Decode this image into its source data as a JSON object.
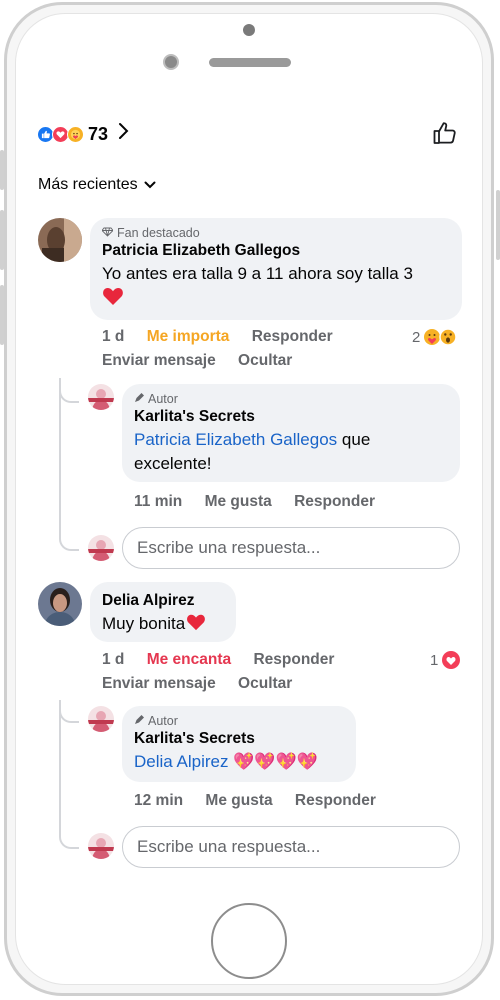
{
  "header": {
    "reaction_icons": [
      "like-icon",
      "love-icon",
      "care-icon"
    ],
    "reaction_count": "73",
    "like_icon": "thumbs-up-icon"
  },
  "sort": {
    "label": "Más recientes"
  },
  "comments": [
    {
      "badge": "Fan destacado",
      "author": "Patricia Elizabeth Gallegos",
      "text": "Yo antes era talla 9 a 11 ahora soy talla 3",
      "emoji": "❤️",
      "time": "1 d",
      "reaction_action": "Me importa",
      "reply_label": "Responder",
      "send_message": "Enviar mensaje",
      "hide": "Ocultar",
      "reaction_count": "2",
      "reply": {
        "badge": "Autor",
        "author": "Karlita's Secrets",
        "mention": "Patricia Elizabeth Gallegos",
        "text": "que excelente!",
        "time": "11 min",
        "like": "Me gusta",
        "reply_label": "Responder"
      },
      "input_placeholder": "Escribe una respuesta..."
    },
    {
      "author": "Delia Alpirez",
      "text": "Muy bonita",
      "emoji": "❤️",
      "time": "1 d",
      "reaction_action": "Me encanta",
      "reply_label": "Responder",
      "send_message": "Enviar mensaje",
      "hide": "Ocultar",
      "reaction_count": "1",
      "reply": {
        "badge": "Autor",
        "author": "Karlita's Secrets",
        "mention": "Delia Alpirez",
        "emojis": "💖💖💖💖",
        "time": "12 min",
        "like": "Me gusta",
        "reply_label": "Responder"
      },
      "input_placeholder": "Escribe una respuesta..."
    }
  ],
  "colors": {
    "accent": "#1877f2",
    "mention": "#1a64c8",
    "importa": "#f5a623",
    "encanta": "#e53750",
    "bubble": "#f0f2f5"
  }
}
